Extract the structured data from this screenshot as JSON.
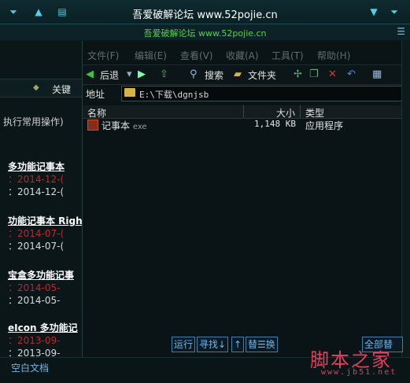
{
  "top": {
    "title": "吾爱破解论坛 www.52pojie.cn"
  },
  "sub": {
    "title": "吾爱破解论坛 www.52pojie.cn"
  },
  "background_window": {
    "search_label": "关键",
    "ops_text": "执行常用操作)",
    "items": [
      {
        "title": "多功能记事本",
        "date1": "：2014-12-(",
        "date2": "：2014-12-("
      },
      {
        "title": "功能记事本 Righ",
        "date1": "：2014-07-(",
        "date2": "：2014-07-("
      },
      {
        "title": "宝盒多功能记事",
        "date1": "：2014-05-",
        "date2": "：2014-05-"
      },
      {
        "title": "eIcon 多功能记",
        "date1": "：2013-09-",
        "date2": "：2013-09-"
      }
    ]
  },
  "explorer": {
    "menu": [
      "文件(F)",
      "编辑(E)",
      "查看(V)",
      "收藏(A)",
      "工具(T)",
      "帮助(H)"
    ],
    "toolbar": {
      "back": "后退",
      "search": "搜索",
      "folders": "文件夹"
    },
    "address": {
      "label": "地址",
      "path": "E:\\下载\\dgnjsb"
    },
    "columns": {
      "name": "名称",
      "size": "大小",
      "type": "类型"
    },
    "files": [
      {
        "name": "记事本",
        "ext": "exe",
        "size": "1,148 KB",
        "type": "应用程序"
      }
    ]
  },
  "bottom_toolbar": {
    "run": "运行",
    "find": "寻找↓",
    "up": "↑",
    "replace": "替☰换",
    "all": "全部替换"
  },
  "status": {
    "blank_doc": "空白文档"
  },
  "watermark": {
    "big": "脚本之家",
    "small": "www.jb51.net"
  }
}
